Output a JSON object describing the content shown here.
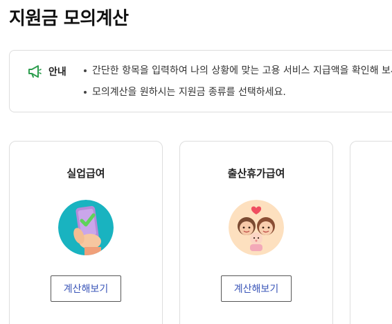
{
  "page": {
    "title": "지원금 모의계산"
  },
  "notice": {
    "icon": "megaphone-icon",
    "label": "안내",
    "items": [
      "간단한 항목을 입력하여 나의 상황에 맞는 고용 서비스 지급액을 확인해 보세요.",
      "모의계산을 원하시는 지원금 종류를 선택하세요."
    ]
  },
  "cards": [
    {
      "title": "실업급여",
      "illustration": "phone-check-illustration",
      "button_label": "계산해보기"
    },
    {
      "title": "출산휴가급여",
      "illustration": "parents-baby-illustration",
      "button_label": "계산해보기"
    }
  ],
  "colors": {
    "accent_green": "#2e9e4f",
    "button_text": "#3a55b8",
    "card_border": "#dddddd",
    "teal_circle": "#19b3c0",
    "peach_circle": "#fde0bf"
  }
}
